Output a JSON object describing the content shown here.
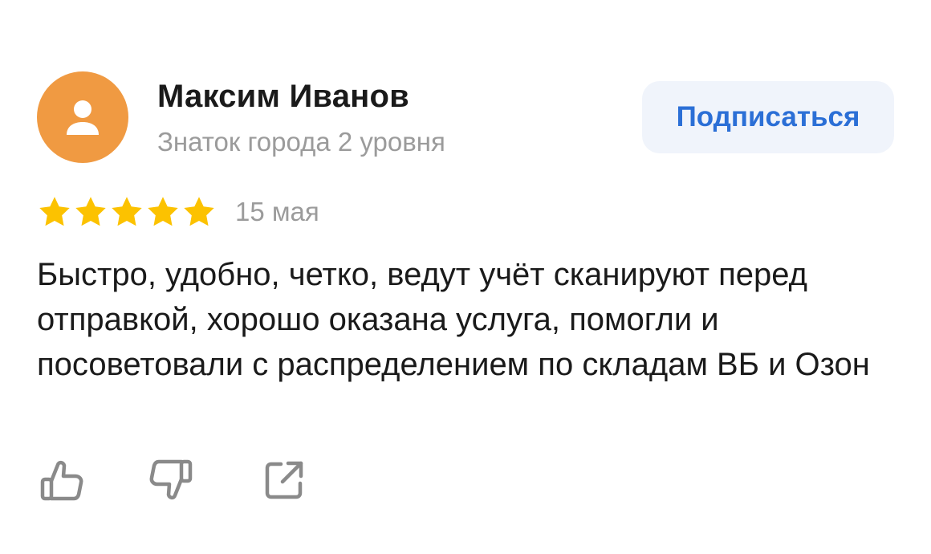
{
  "review": {
    "author": {
      "name": "Максим Иванов",
      "level": "Знаток города 2 уровня",
      "avatar_icon": "user-silhouette-icon",
      "avatar_color": "#f09a42"
    },
    "subscribe_label": "Подписаться",
    "rating": {
      "value": 5,
      "max": 5,
      "star_color": "#fcc200"
    },
    "date": "15 мая",
    "text": "Быстро, удобно, четко, ведут учёт сканируют перед отправкой, хорошо оказана услуга, помогли и посоветовали с распределением по складам ВБ и Озон",
    "actions": [
      {
        "name": "like",
        "icon": "thumbs-up-icon"
      },
      {
        "name": "dislike",
        "icon": "thumbs-down-icon"
      },
      {
        "name": "share",
        "icon": "share-icon"
      }
    ]
  },
  "colors": {
    "accent": "#2b6fd6",
    "button_bg": "#f0f4fb",
    "muted_text": "#9b9b9b",
    "icon_gray": "#8a8a8a"
  }
}
